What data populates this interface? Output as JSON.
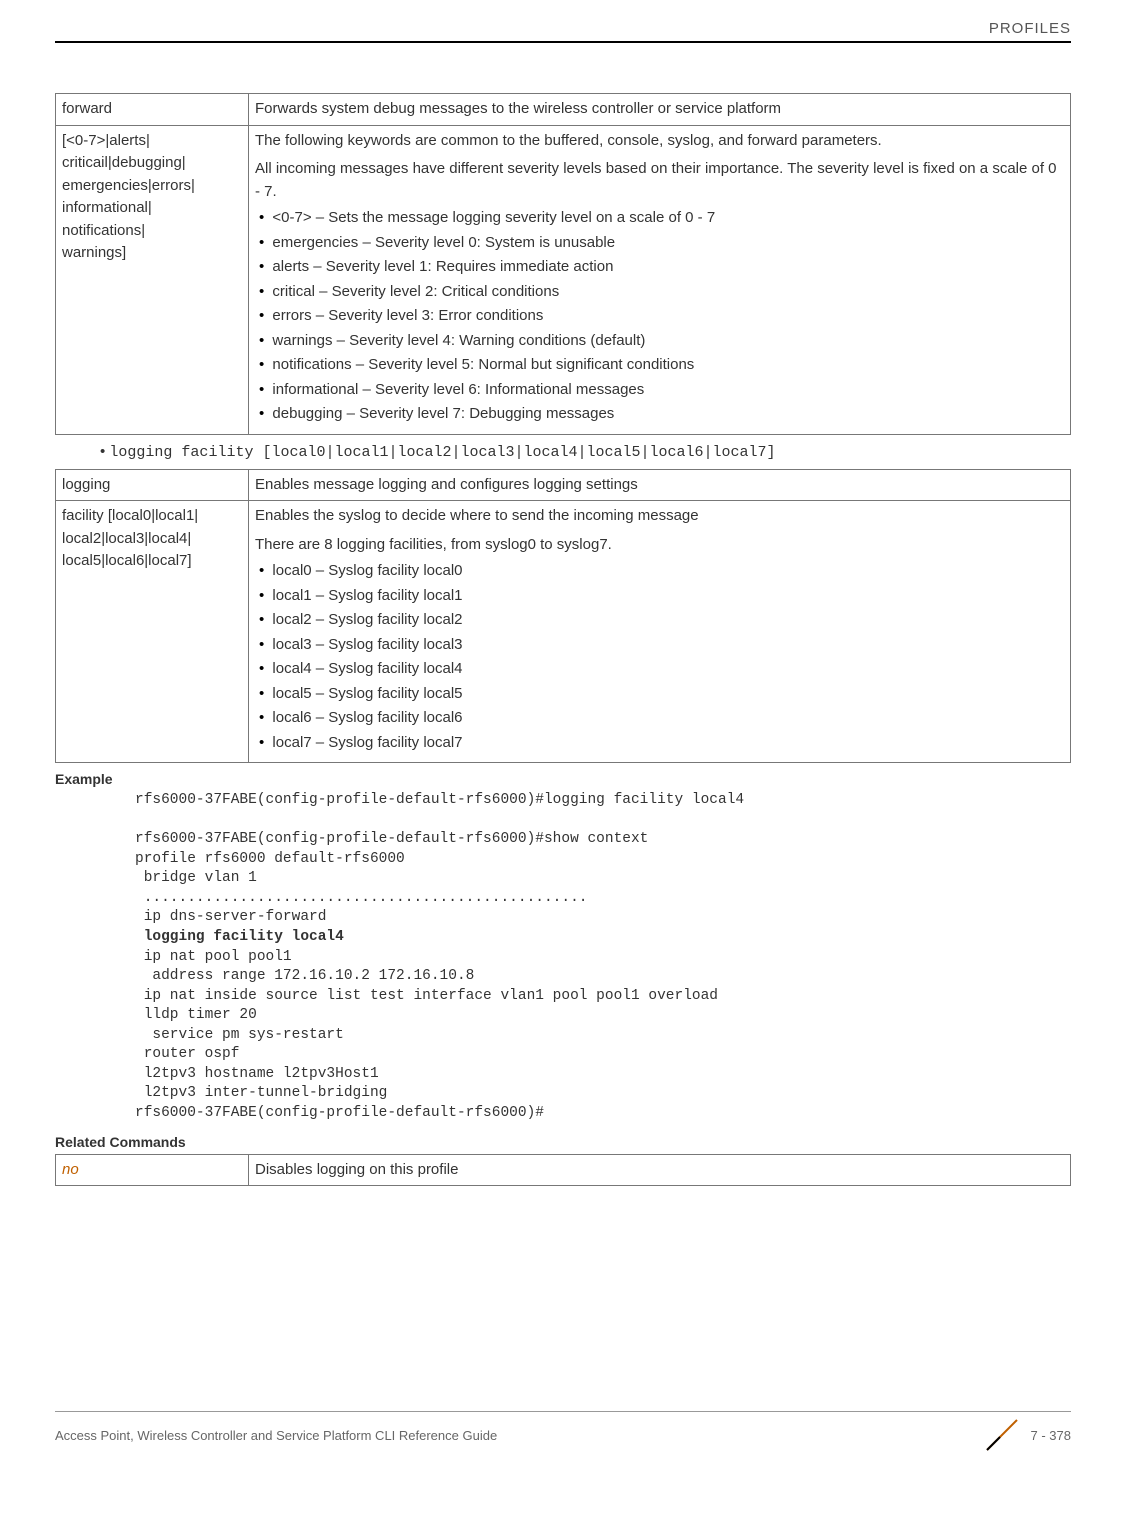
{
  "header": {
    "title": "PROFILES"
  },
  "table1": {
    "rows": [
      {
        "param": "forward",
        "desc_html": "Forwards system debug messages to the wireless controller or service platform"
      },
      {
        "param": "[<0-7>|alerts|\ncriticail|debugging|\nemergencies|errors|\ninformational|\nnotifications|\nwarnings]",
        "intro1": "The following keywords are common to the buffered, console, syslog, and forward parameters.",
        "intro2": "All incoming messages have different severity levels based on their importance. The severity level is fixed on a scale of 0 - 7.",
        "items": [
          "<0-7> – Sets the message logging severity level on a scale of 0 - 7",
          "emergencies – Severity level 0: System is unusable",
          "alerts – Severity level 1: Requires immediate action",
          "critical – Severity level 2: Critical conditions",
          "errors – Severity level 3: Error conditions",
          "warnings – Severity level 4: Warning conditions (default)",
          "notifications – Severity level 5: Normal but significant conditions",
          "informational – Severity level 6: Informational messages",
          "debugging – Severity level 7: Debugging messages"
        ]
      }
    ]
  },
  "mid_bullet": "logging facility [local0|local1|local2|local3|local4|local5|local6|local7]",
  "table2": {
    "rows": [
      {
        "param": "logging",
        "desc_html": "Enables message logging and configures logging settings"
      },
      {
        "param": "facility [local0|local1|\nlocal2|local3|local4|\nlocal5|local6|local7]",
        "intro1": "Enables the syslog to decide where to send the incoming message",
        "intro2": "There are 8 logging facilities, from syslog0 to syslog7.",
        "items": [
          "local0 – Syslog facility local0",
          "local1 – Syslog facility local1",
          "local2 – Syslog facility local2",
          "local3 – Syslog facility local3",
          "local4 – Syslog facility local4",
          "local5 – Syslog facility local5",
          "local6 – Syslog facility local6",
          "local7 – Syslog facility local7"
        ]
      }
    ]
  },
  "example_label": "Example",
  "example": {
    "l1": "rfs6000-37FABE(config-profile-default-rfs6000)#logging facility local4",
    "l2": "",
    "l3": "rfs6000-37FABE(config-profile-default-rfs6000)#show context",
    "l4": "profile rfs6000 default-rfs6000",
    "l5": " bridge vlan 1",
    "l6": " ...................................................",
    "l7": " ip dns-server-forward",
    "l8": " logging facility local4",
    "l9": " ip nat pool pool1",
    "l10": "  address range 172.16.10.2 172.16.10.8",
    "l11": " ip nat inside source list test interface vlan1 pool pool1 overload",
    "l12": " lldp timer 20",
    "l13": "  service pm sys-restart",
    "l14": " router ospf",
    "l15": " l2tpv3 hostname l2tpv3Host1",
    "l16": " l2tpv3 inter-tunnel-bridging",
    "l17": "rfs6000-37FABE(config-profile-default-rfs6000)#"
  },
  "related_label": "Related Commands",
  "table3": {
    "param": "no",
    "desc": "Disables logging on this profile"
  },
  "footer": {
    "left": "Access Point, Wireless Controller and Service Platform CLI Reference Guide",
    "page": "7 - 378"
  }
}
